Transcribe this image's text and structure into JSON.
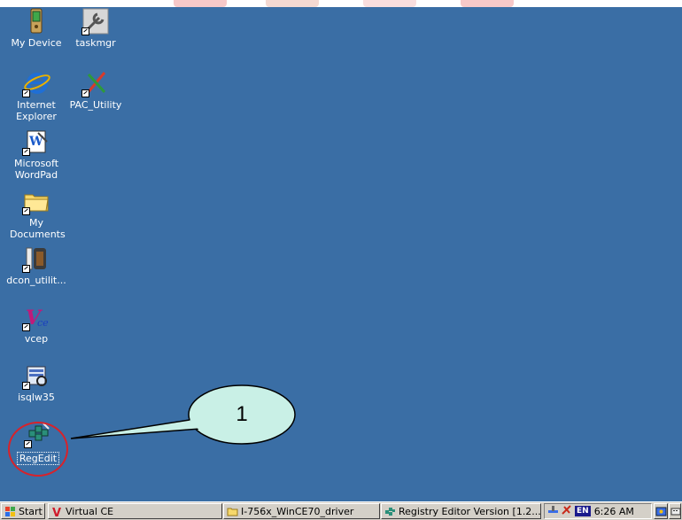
{
  "desktop": {
    "icons": [
      {
        "label": "My Device",
        "icon": "handheld-device-icon"
      },
      {
        "label": "taskmgr",
        "icon": "wrench-tool-icon"
      },
      {
        "label": "Internet Explorer",
        "icon": "internet-explorer-icon"
      },
      {
        "label": "PAC_Utility",
        "icon": "pac-utility-icon"
      },
      {
        "label": "Microsoft WordPad",
        "icon": "wordpad-icon"
      },
      {
        "label": "My Documents",
        "icon": "folder-icon"
      },
      {
        "label": "dcon_utilit...",
        "icon": "dcon-utility-icon"
      },
      {
        "label": "vcep",
        "icon": "vcep-icon"
      },
      {
        "label": "isqlw35",
        "icon": "sql-icon"
      },
      {
        "label": "RegEdit",
        "icon": "regedit-icon"
      }
    ]
  },
  "callout": {
    "number": "1"
  },
  "taskbar": {
    "start_label": "Start",
    "buttons": [
      {
        "label": "Virtual CE",
        "icon": "virtual-ce-icon"
      },
      {
        "label": "I-756x_WinCE70_driver",
        "icon": "folder-icon"
      },
      {
        "label": "Registry Editor Version [1.2...",
        "icon": "regedit-icon"
      }
    ],
    "tray": {
      "lang": "EN",
      "time": "6:26 AM"
    }
  },
  "colors": {
    "desktop": "#3a6ea5",
    "taskbar": "#d4d0c8",
    "callout_ring": "#d8222a",
    "callout_fill": "#c9f0e6"
  }
}
